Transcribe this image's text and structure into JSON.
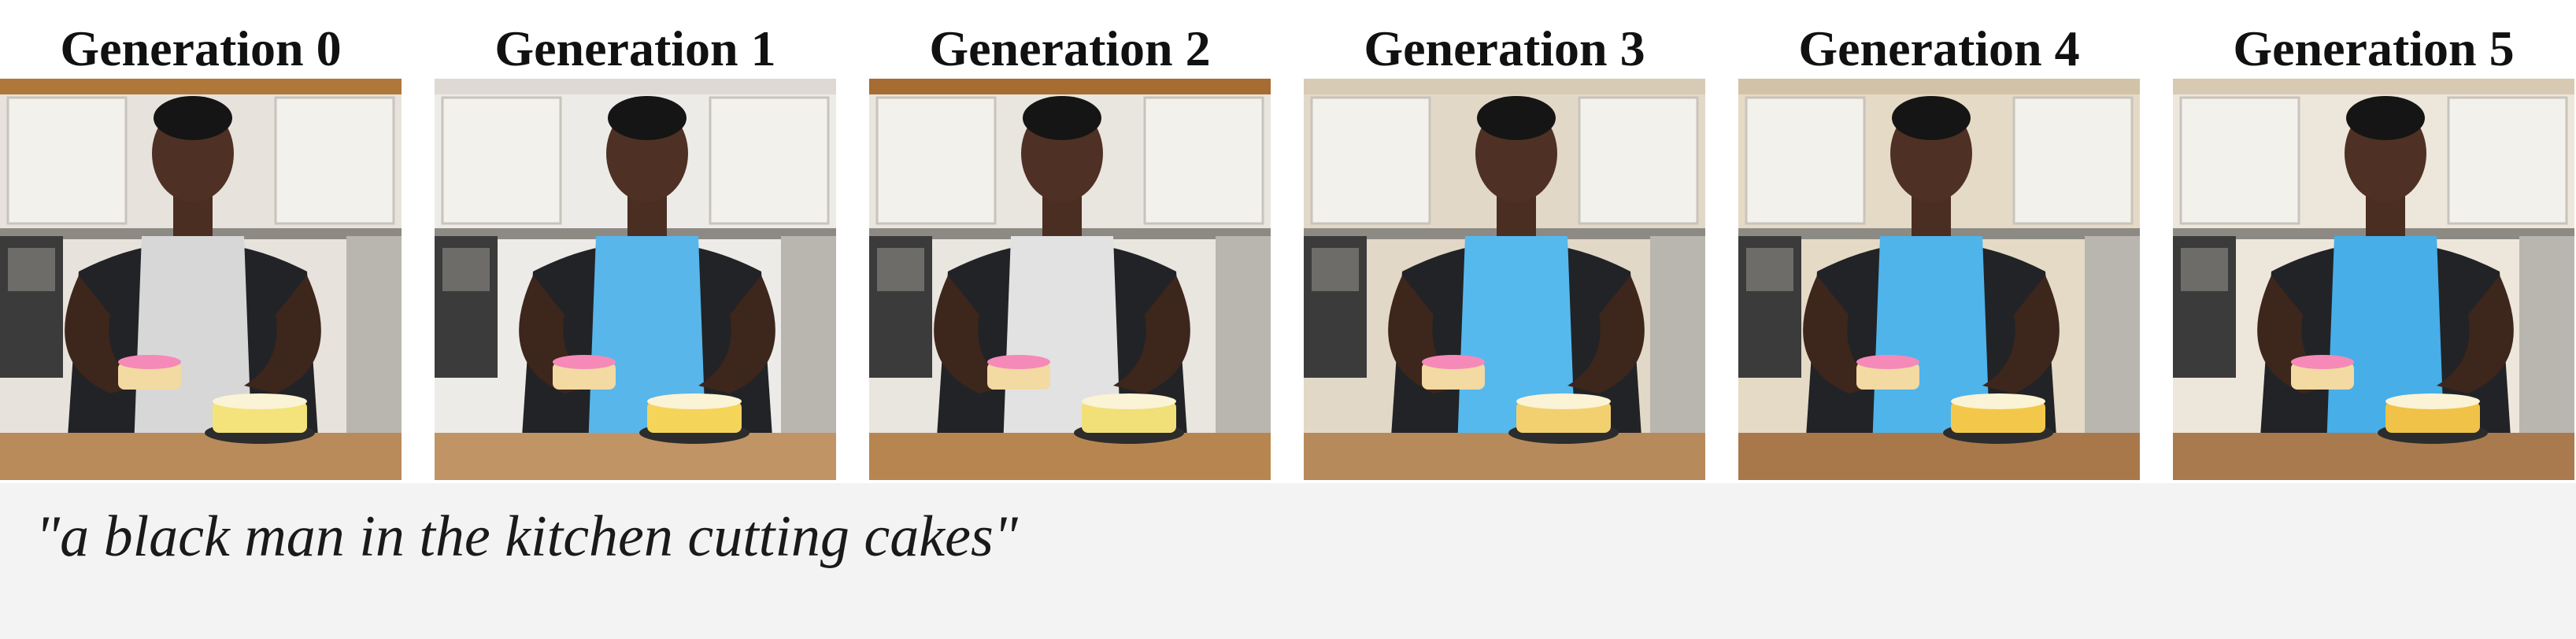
{
  "panels": [
    {
      "title": "Generation 0",
      "apron_color": "#d7d7d7",
      "cabinet_color": "#e7e3dc",
      "counter_color": "#b98b5a",
      "top_strip_color": "#b0773a",
      "cake_icing": "#f4e37a"
    },
    {
      "title": "Generation 1",
      "apron_color": "#58b6ea",
      "cabinet_color": "#ecebe7",
      "counter_color": "#c19465",
      "top_strip_color": "#ded9d2",
      "cake_icing": "#f5d45a"
    },
    {
      "title": "Generation 2",
      "apron_color": "#e2e2e2",
      "cabinet_color": "#e9e5df",
      "counter_color": "#b78650",
      "top_strip_color": "#a66c32",
      "cake_icing": "#f1df78"
    },
    {
      "title": "Generation 3",
      "apron_color": "#56b9ee",
      "cabinet_color": "#e2d8c7",
      "counter_color": "#b78a5c",
      "top_strip_color": "#d8cbb6",
      "cake_icing": "#f2d070"
    },
    {
      "title": "Generation 4",
      "apron_color": "#4fb4ea",
      "cabinet_color": "#e5dac6",
      "counter_color": "#a9784a",
      "top_strip_color": "#d2c3a8",
      "cake_icing": "#f3c84a"
    },
    {
      "title": "Generation 5",
      "apron_color": "#47aee8",
      "cabinet_color": "#ede6da",
      "counter_color": "#a97a4e",
      "top_strip_color": "#d8c9b2",
      "cake_icing": "#f0c247"
    }
  ],
  "caption": "\"a black man in the kitchen cutting cakes\""
}
